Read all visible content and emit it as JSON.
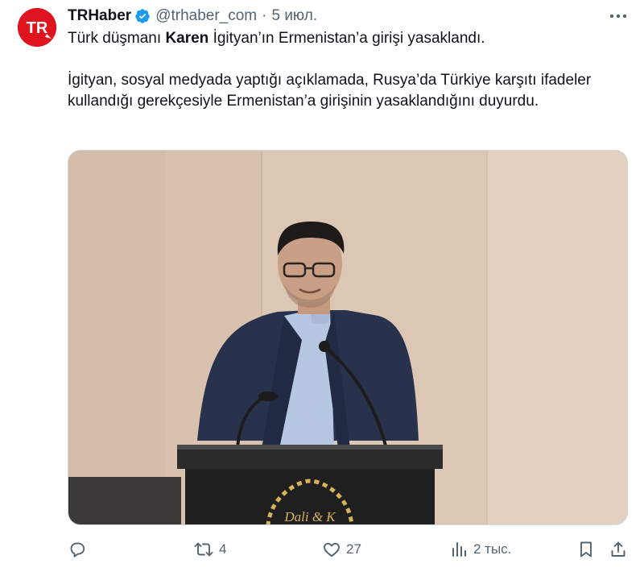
{
  "tweet": {
    "author": {
      "avatar_text": "TR",
      "display_name": "TRHaber",
      "handle": "@trhaber_com",
      "separator": "·",
      "time": "5 июл."
    },
    "text": {
      "line1_pre": "Türk düşmanı ",
      "line1_bold": "Karen",
      "line1_post": " İgityan’ın Ermenistan’a girişi yasaklandı.",
      "paragraph2": "İgityan, sosyal medyada yaptığı açıklamada, Rusya’da Türkiye karşıtı ifadeler kullandığı gerekçesiyle Ermenistan’a girişinin yasaklandığını duyurdu."
    },
    "media": {
      "podium_logo_text": "Dali & K"
    },
    "actions": {
      "reply_count": "",
      "retweet_count": "4",
      "like_count": "27",
      "views_count": "2 тыс."
    }
  },
  "colors": {
    "accent": "#1d9bf0",
    "brand_red": "#e0141e",
    "secondary_text": "#536471"
  }
}
